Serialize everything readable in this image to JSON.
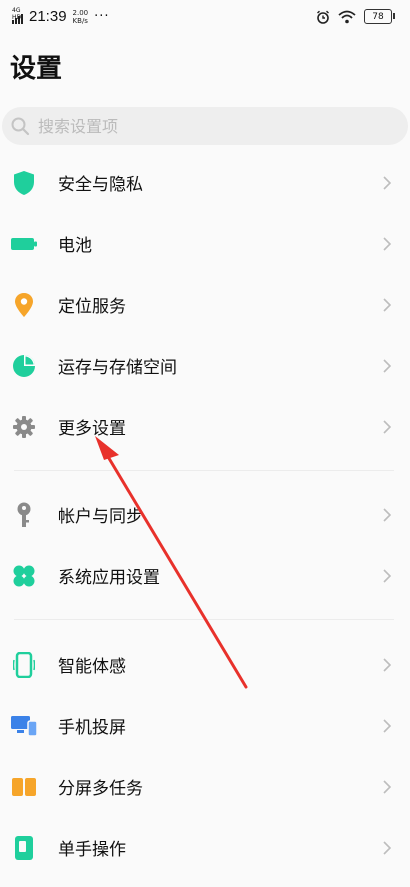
{
  "status_bar": {
    "signal": "4G HD",
    "time": "21:39",
    "net_speed_value": "2.00",
    "net_speed_unit": "KB/s",
    "more": "···",
    "battery": "78"
  },
  "page": {
    "title": "设置"
  },
  "search": {
    "placeholder": "搜索设置项"
  },
  "groups": [
    {
      "items": [
        {
          "label": "安全与隐私",
          "icon": "shield-icon"
        },
        {
          "label": "电池",
          "icon": "battery-icon"
        },
        {
          "label": "定位服务",
          "icon": "location-pin-icon"
        },
        {
          "label": "运存与存储空间",
          "icon": "pie-chart-icon"
        },
        {
          "label": "更多设置",
          "icon": "gear-icon"
        }
      ]
    },
    {
      "items": [
        {
          "label": "帐户与同步",
          "icon": "key-icon"
        },
        {
          "label": "系统应用设置",
          "icon": "clover-icon"
        }
      ]
    },
    {
      "items": [
        {
          "label": "智能体感",
          "icon": "phone-motion-icon"
        },
        {
          "label": "手机投屏",
          "icon": "screen-cast-icon"
        },
        {
          "label": "分屏多任务",
          "icon": "split-screen-icon"
        },
        {
          "label": "单手操作",
          "icon": "one-hand-icon"
        }
      ]
    }
  ],
  "colors": {
    "green": "#1fcf9c",
    "orange": "#f6a52a",
    "blue": "#3b82e8",
    "gray": "#8a8a8a",
    "arrow": "#e8312b"
  }
}
